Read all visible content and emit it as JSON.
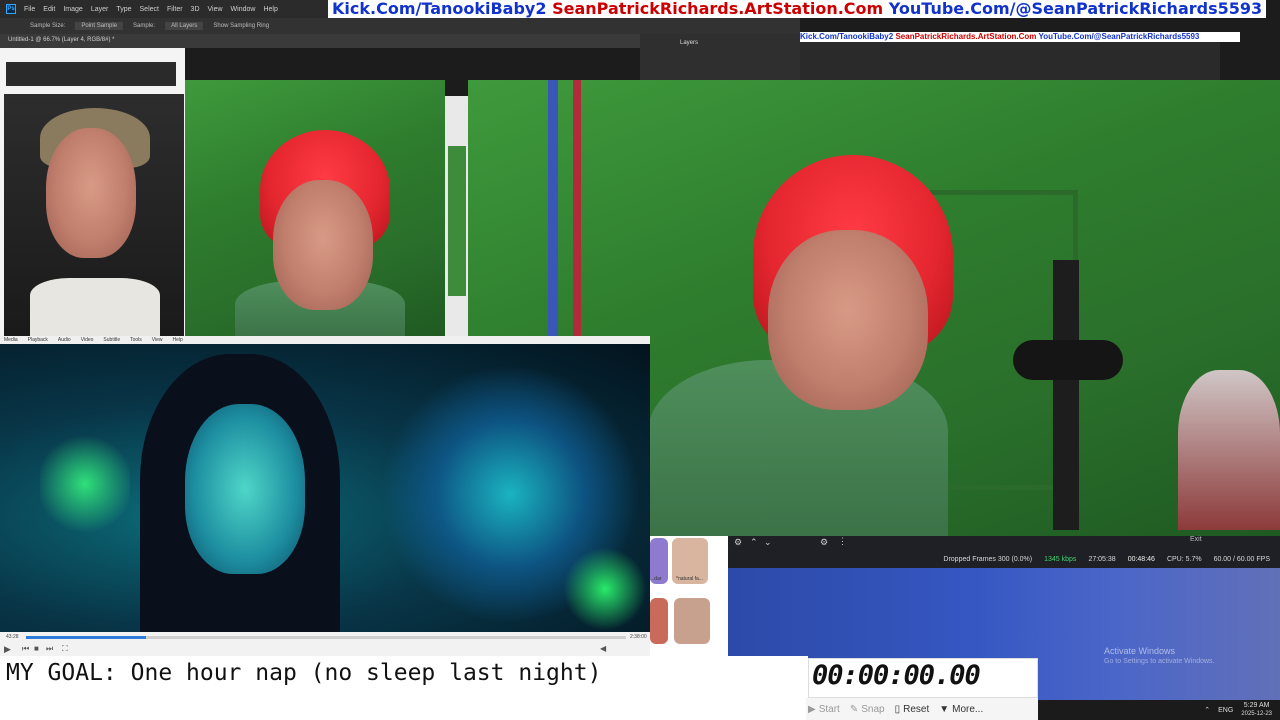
{
  "photoshop": {
    "menu": [
      "File",
      "Edit",
      "Image",
      "Layer",
      "Type",
      "Select",
      "Filter",
      "3D",
      "View",
      "Window",
      "Help"
    ],
    "options": [
      "Sample Size:",
      "Point Sample",
      "Sample:",
      "All Layers",
      "Show Sampling Ring"
    ],
    "doc_tab": "Untitled-1 @ 66.7% (Layer 4, RGB/8#) *",
    "layers_tab": "Layers"
  },
  "banner": {
    "kick": "Kick.Com/TanookiBaby2",
    "artstation": "SeanPatrickRichards.ArtStation.Com",
    "youtube": "YouTube.Com/@SeanPatrickRichards5593"
  },
  "video_player": {
    "menu": [
      "Media",
      "Playback",
      "Audio",
      "Video",
      "Subtitle",
      "Tools",
      "View",
      "Help"
    ],
    "time_elapsed": "43:28",
    "time_total": "2:38:00",
    "progress": 0.2
  },
  "goal_text": "MY GOAL: One hour nap (no sleep last night)",
  "stopwatch": {
    "time": "00:00:00.00",
    "start_label": "Start",
    "snap_label": "Snap",
    "reset_label": "Reset",
    "more_label": "More..."
  },
  "obs": {
    "exit_label": "Exit",
    "dropped_frames": "Dropped Frames 300 (0.0%)",
    "bitrate": "1345 kbps",
    "stream_time": "27:05:38",
    "rec_time": "00:48:46",
    "cpu": "CPU: 5.7%",
    "fps": "60.00 / 60.00 FPS"
  },
  "windows": {
    "activate_title": "Activate Windows",
    "activate_sub": "Go to Settings to activate Windows.",
    "lang": "ENG",
    "time": "5:29 AM",
    "date": "2025-12-23"
  },
  "thumb_labels": [
    "*natural fa...",
    "...dar"
  ],
  "colors": {
    "banner_blue": "#1133cc",
    "banner_red": "#cc0000",
    "green_wall": "#2e7d2e",
    "hair_red": "#e4262f"
  }
}
